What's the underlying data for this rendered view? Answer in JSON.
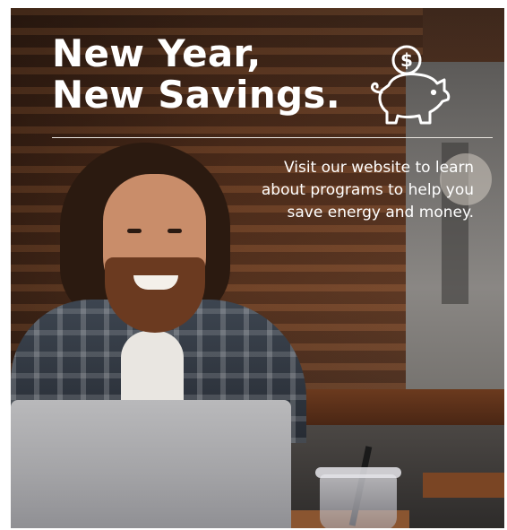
{
  "ad": {
    "headline_line1": "New Year,",
    "headline_line2": "New Savings.",
    "body_line1": "Visit our website to learn",
    "body_line2": "about programs to help you",
    "body_line3": "save energy and money.",
    "icon": "piggy-bank-with-dollar-coin",
    "text_color": "#ffffff"
  }
}
